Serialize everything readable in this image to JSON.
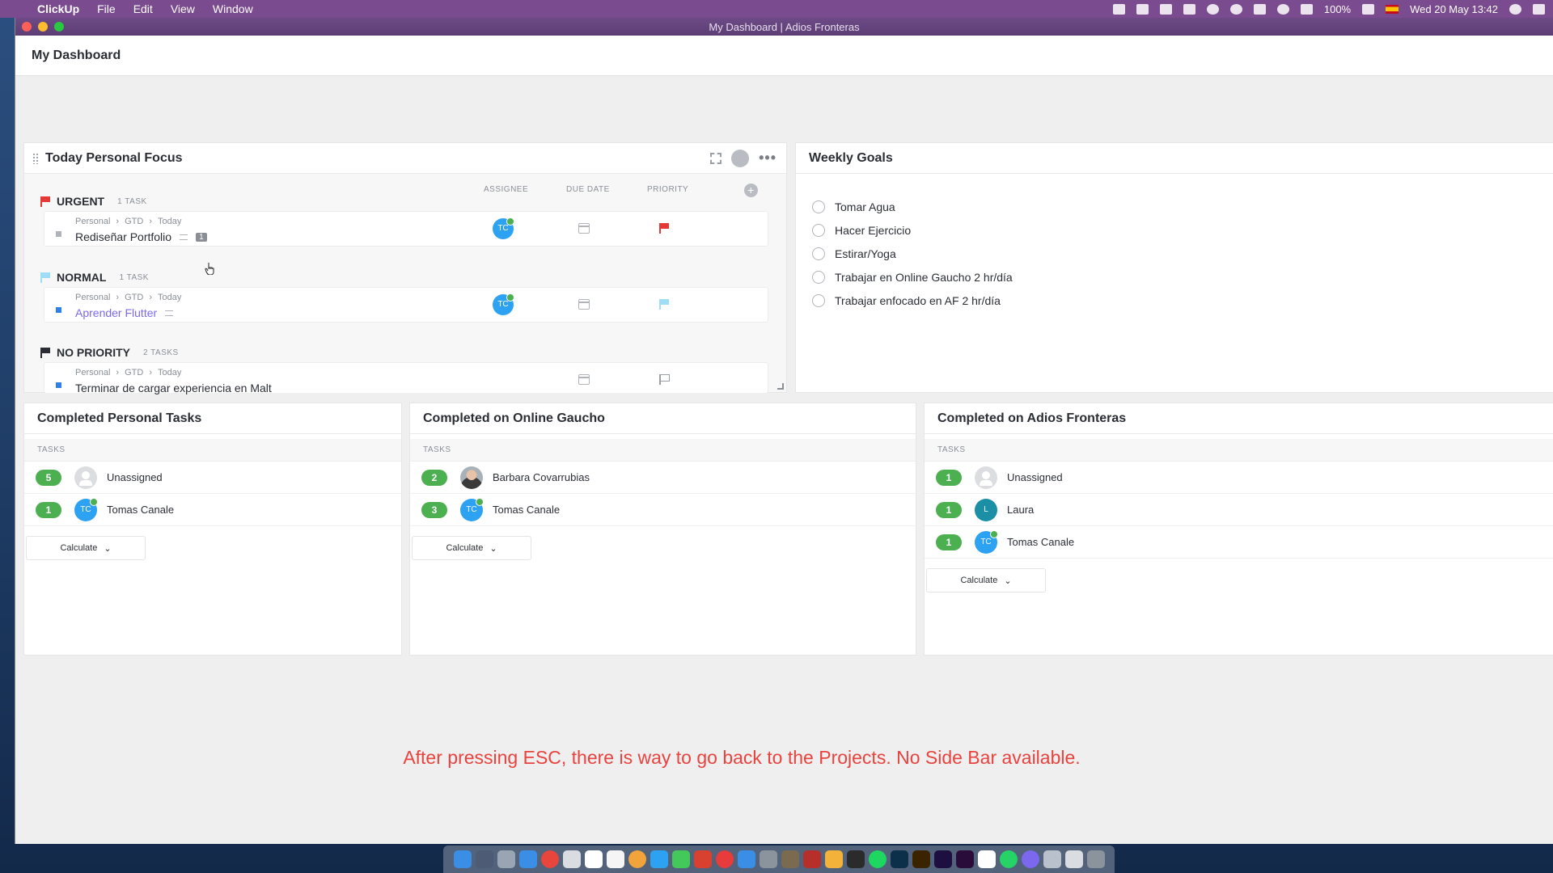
{
  "menubar": {
    "app": "ClickUp",
    "menus": [
      "File",
      "Edit",
      "View",
      "Window"
    ],
    "battery": "100%",
    "datetime": "Wed 20 May  13:42"
  },
  "window": {
    "title": "My Dashboard | Adios Fronteras"
  },
  "dashboard": {
    "title": "My Dashboard"
  },
  "focus": {
    "title": "Today Personal Focus",
    "columns": {
      "assignee": "ASSIGNEE",
      "due_date": "DUE DATE",
      "priority": "PRIORITY"
    },
    "groups": [
      {
        "name": "URGENT",
        "count": "1 TASK",
        "flag_color": "#e53935",
        "task": {
          "crumbs": [
            "Personal",
            "GTD",
            "Today"
          ],
          "name": "Rediseñar Portfolio",
          "subtasks": "1",
          "assignee": "TC",
          "status_color": "#b0b4ba"
        }
      },
      {
        "name": "NORMAL",
        "count": "1 TASK",
        "flag_color": "#9fdcf5",
        "task": {
          "crumbs": [
            "Personal",
            "GTD",
            "Today"
          ],
          "name": "Aprender Flutter",
          "assignee": "TC",
          "status_color": "#2f80ed"
        }
      },
      {
        "name": "NO PRIORITY",
        "count": "2 TASKS",
        "flag_color": "#2a2e34",
        "task": {
          "crumbs": [
            "Personal",
            "GTD",
            "Today"
          ],
          "name": "Terminar de cargar experiencia en Malt",
          "status_color": "#2f80ed"
        }
      }
    ]
  },
  "goals": {
    "title": "Weekly Goals",
    "items": [
      "Tomar Agua",
      "Hacer Ejercicio",
      "Estirar/Yoga",
      "Trabajar en Online Gaucho 2 hr/día",
      "Trabajar enfocado en AF 2 hr/día"
    ]
  },
  "completed": [
    {
      "title": "Completed Personal Tasks",
      "tasks_label": "TASKS",
      "calculate": "Calculate",
      "rows": [
        {
          "count": "5",
          "name": "Unassigned",
          "avatar": "unassigned"
        },
        {
          "count": "1",
          "name": "Tomas Canale",
          "avatar": "TC"
        }
      ]
    },
    {
      "title": "Completed on Online Gaucho",
      "tasks_label": "TASKS",
      "calculate": "Calculate",
      "rows": [
        {
          "count": "2",
          "name": "Barbara Covarrubias",
          "avatar": "photo"
        },
        {
          "count": "3",
          "name": "Tomas Canale",
          "avatar": "TC"
        }
      ]
    },
    {
      "title": "Completed on Adios Fronteras",
      "tasks_label": "TASKS",
      "calculate": "Calculate",
      "rows": [
        {
          "count": "1",
          "name": "Unassigned",
          "avatar": "unassigned"
        },
        {
          "count": "1",
          "name": "Laura",
          "avatar": "L"
        },
        {
          "count": "1",
          "name": "Tomas Canale",
          "avatar": "TC"
        }
      ]
    }
  ],
  "annotation": "After pressing ESC, there is way to go back to the Projects. No Side Bar available.",
  "colors": {
    "accent": "#7b68ee",
    "success": "#4caf50",
    "annotation": "#e8433e",
    "menubar": "#7a4b8e"
  }
}
